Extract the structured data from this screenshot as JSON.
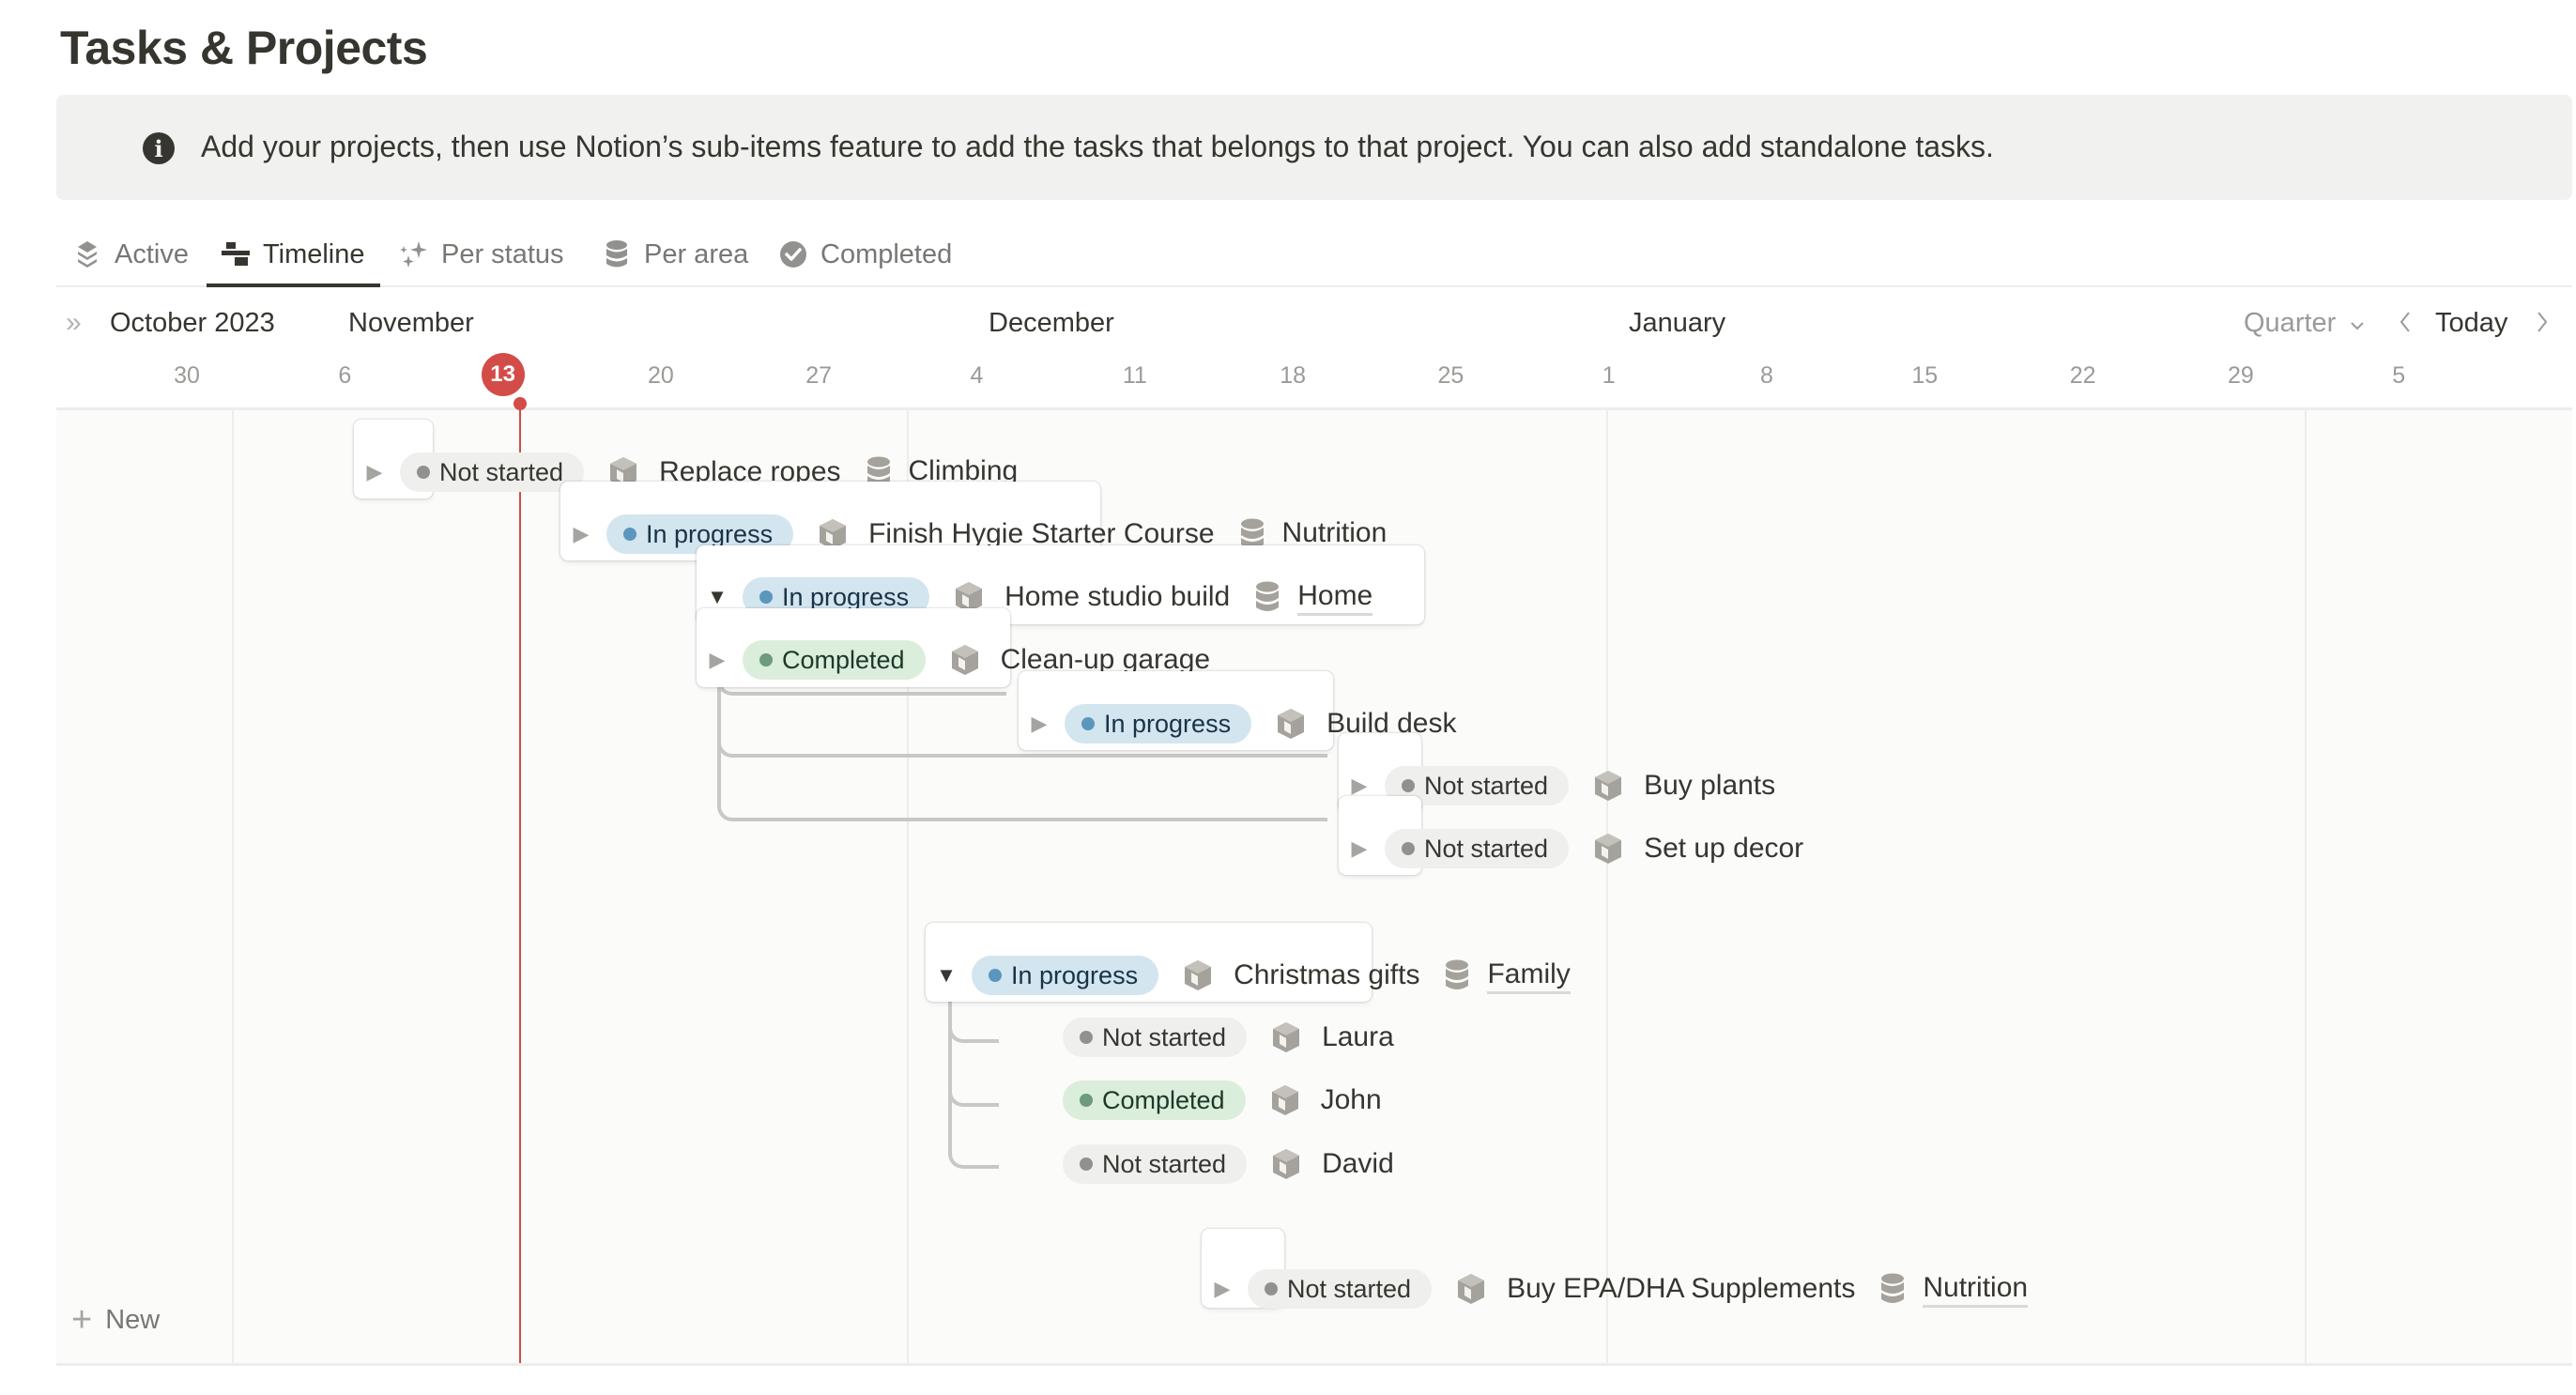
{
  "page": {
    "title": "Tasks & Projects"
  },
  "banner": {
    "icon": "info-icon",
    "text": "Add your projects, then use Notion’s sub-items feature to add the tasks that belongs to that project. You can also add standalone tasks."
  },
  "tabs": [
    {
      "label": "Active",
      "icon": "layers-icon",
      "active": false
    },
    {
      "label": "Timeline",
      "icon": "timeline-icon",
      "active": true
    },
    {
      "label": "Per status",
      "icon": "sparkles-icon",
      "active": false
    },
    {
      "label": "Per area",
      "icon": "database-icon",
      "active": false
    },
    {
      "label": "Completed",
      "icon": "check-circle-icon",
      "active": false
    }
  ],
  "timeline": {
    "months": [
      "October 2023",
      "November",
      "December",
      "January"
    ],
    "days": [
      "30",
      "6",
      "13",
      "20",
      "27",
      "4",
      "11",
      "18",
      "25",
      "1",
      "8",
      "15",
      "22",
      "29",
      "5"
    ],
    "today": "13",
    "controls": {
      "zoom": "Quarter",
      "today": "Today"
    },
    "new_label": "New"
  },
  "items": [
    {
      "status": "Not started",
      "name": "Replace ropes",
      "area": "Climbing",
      "toggle": "collapsed"
    },
    {
      "status": "In progress",
      "name": "Finish Hygie Starter Course",
      "area": "Nutrition",
      "toggle": "collapsed"
    },
    {
      "status": "In progress",
      "name": "Home studio build",
      "area": "Home",
      "toggle": "expanded"
    },
    {
      "status": "Completed",
      "name": "Clean-up garage",
      "area": "",
      "toggle": "collapsed"
    },
    {
      "status": "In progress",
      "name": "Build desk",
      "area": "",
      "toggle": "collapsed"
    },
    {
      "status": "Not started",
      "name": "Buy plants",
      "area": "",
      "toggle": "collapsed"
    },
    {
      "status": "Not started",
      "name": "Set up decor",
      "area": "",
      "toggle": "collapsed"
    },
    {
      "status": "In progress",
      "name": "Christmas gifts",
      "area": "Family",
      "toggle": "expanded"
    },
    {
      "status": "Not started",
      "name": "Laura",
      "area": "",
      "toggle": "none"
    },
    {
      "status": "Completed",
      "name": "John",
      "area": "",
      "toggle": "none"
    },
    {
      "status": "Not started",
      "name": "David",
      "area": "",
      "toggle": "none"
    },
    {
      "status": "Not started",
      "name": "Buy EPA/DHA Supplements",
      "area": "Nutrition",
      "toggle": "collapsed"
    }
  ],
  "colors": {
    "today": "#d44c47",
    "not_started_bg": "#efefed",
    "in_progress_bg": "#d3e5ef",
    "completed_bg": "#dbeddb"
  }
}
